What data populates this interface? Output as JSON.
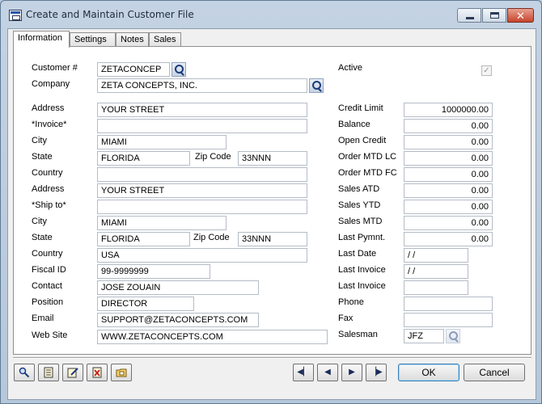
{
  "window": {
    "title": "Create and Maintain Customer File"
  },
  "tabs": [
    "Information",
    "Settings",
    "Notes",
    "Sales"
  ],
  "left": {
    "customer_label": "Customer #",
    "customer_value": "ZETACONCEP",
    "company_label": "Company",
    "company_value": "ZETA CONCEPTS, INC.",
    "address1_label": "Address",
    "address1_value": "YOUR STREET",
    "invoice_label": "*Invoice*",
    "invoice_value": "",
    "city1_label": "City",
    "city1_value": "MIAMI",
    "state1_label": "State",
    "state1_value": "FLORIDA",
    "zip1_label": "Zip Code",
    "zip1_value": "33NNN",
    "country1_label": "Country",
    "country1_value": "",
    "address2_label": "Address",
    "address2_value": "YOUR STREET",
    "shipto_label": "*Ship to*",
    "shipto_value": "",
    "city2_label": "City",
    "city2_value": "MIAMI",
    "state2_label": "State",
    "state2_value": "FLORIDA",
    "zip2_label": "Zip Code",
    "zip2_value": "33NNN",
    "country2_label": "Country",
    "country2_value": "USA",
    "fiscal_label": "Fiscal ID",
    "fiscal_value": "99-9999999",
    "contact_label": "Contact",
    "contact_value": "JOSE ZOUAIN",
    "position_label": "Position",
    "position_value": "DIRECTOR",
    "email_label": "Email",
    "email_value": "SUPPORT@ZETACONCEPTS.COM",
    "website_label": "Web Site",
    "website_value": "WWW.ZETACONCEPTS.COM"
  },
  "right": {
    "active_label": "Active",
    "active_mark": "✓",
    "credit_limit_label": "Credit Limit",
    "credit_limit_value": "1000000.00",
    "balance_label": "Balance",
    "balance_value": "0.00",
    "open_credit_label": "Open Credit",
    "open_credit_value": "0.00",
    "order_mtd_lc_label": "Order MTD LC",
    "order_mtd_lc_value": "0.00",
    "order_mtd_fc_label": "Order MTD FC",
    "order_mtd_fc_value": "0.00",
    "sales_atd_label": "Sales ATD",
    "sales_atd_value": "0.00",
    "sales_ytd_label": "Sales YTD",
    "sales_ytd_value": "0.00",
    "sales_mtd_label": "Sales MTD",
    "sales_mtd_value": "0.00",
    "last_pymnt_label": "Last Pymnt.",
    "last_pymnt_value": "0.00",
    "last_date_label": "Last Date",
    "last_date_value": " /  /",
    "last_invoice1_label": "Last Invoice",
    "last_invoice1_value": " /  /",
    "last_invoice2_label": "Last Invoice",
    "last_invoice2_value": "",
    "phone_label": "Phone",
    "phone_value": "",
    "fax_label": "Fax",
    "fax_value": "",
    "salesman_label": "Salesman",
    "salesman_value": "JFZ"
  },
  "nav": {
    "first": "◀▏",
    "prev": "◀",
    "next": "▶",
    "last": "▕▶"
  },
  "buttons": {
    "ok": "OK",
    "cancel": "Cancel"
  },
  "window_controls": {
    "close_glyph": "✕"
  }
}
